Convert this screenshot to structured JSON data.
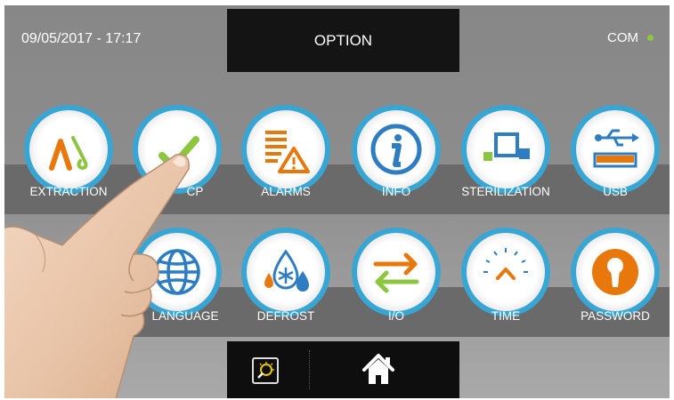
{
  "header": {
    "datetime": "09/05/2017 - 17:17",
    "title": "OPTION",
    "status_label": "COM",
    "status_color": "#8cc63f"
  },
  "menu": {
    "row1": [
      {
        "label": "EXTRACTION",
        "icon": "extraction-icon"
      },
      {
        "label": "CP",
        "icon": "checkmark-icon"
      },
      {
        "label": "ALARMS",
        "icon": "alarms-icon"
      },
      {
        "label": "INFO",
        "icon": "info-icon"
      },
      {
        "label": "STERILIZATION",
        "icon": "sterilization-icon"
      },
      {
        "label": "USB",
        "icon": "usb-icon"
      }
    ],
    "row2": [
      {
        "label": "",
        "icon": "hidden-icon"
      },
      {
        "label": "LANGUAGE",
        "icon": "globe-icon"
      },
      {
        "label": "DEFROST",
        "icon": "defrost-icon"
      },
      {
        "label": "I/O",
        "icon": "io-arrows-icon"
      },
      {
        "label": "TIME",
        "icon": "clock-icon"
      },
      {
        "label": "PASSWORD",
        "icon": "keyhole-icon"
      }
    ]
  },
  "footer": {
    "left_icon": "cleaning-icon",
    "right_icon": "home-icon"
  },
  "colors": {
    "accent_blue": "#38a6d4",
    "orange": "#e8780c",
    "green": "#8cc63f"
  }
}
